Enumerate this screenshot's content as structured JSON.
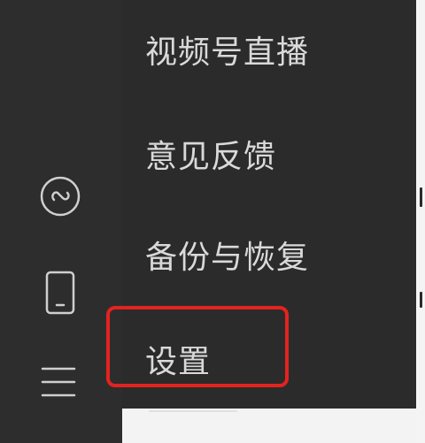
{
  "menu": {
    "items": [
      {
        "label": "视频号直播"
      },
      {
        "label": "意见反馈"
      },
      {
        "label": "备份与恢复"
      },
      {
        "label": "设置"
      }
    ],
    "highlighted_item": "设置"
  },
  "sidebar": {
    "icons": [
      "mini-program-icon",
      "phone-icon",
      "menu-icon"
    ]
  },
  "colors": {
    "background": "#2b2b2b",
    "sidebar": "#2d2d2d",
    "text": "#d9d9d9",
    "highlight": "#e3231f"
  }
}
